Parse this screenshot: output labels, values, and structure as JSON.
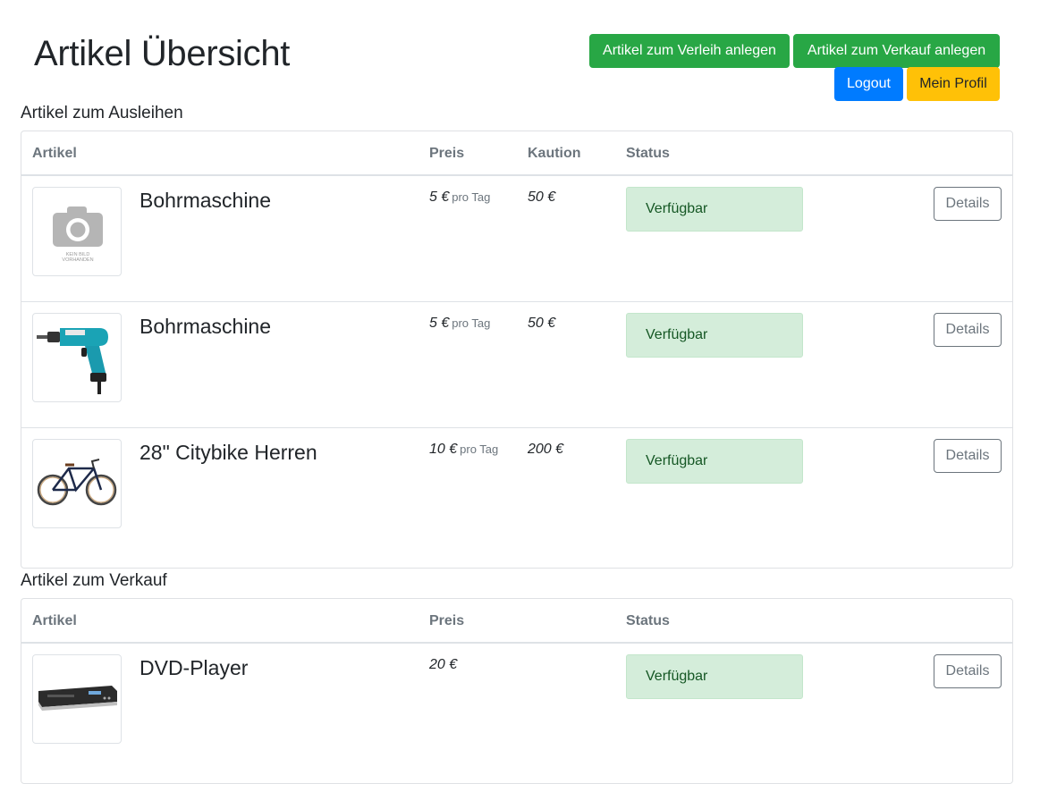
{
  "page": {
    "title": "Artikel Übersicht"
  },
  "header_buttons": {
    "verleih": "Artikel zum Verleih anlegen",
    "verkauf": "Artikel zum Verkauf anlegen",
    "logout": "Logout",
    "profil": "Mein Profil"
  },
  "rental": {
    "title": "Artikel zum Ausleihen",
    "columns": {
      "artikel": "Artikel",
      "preis": "Preis",
      "kaution": "Kaution",
      "status": "Status"
    },
    "items": [
      {
        "name": "Bohrmaschine",
        "price": "5 €",
        "unit": "pro Tag",
        "deposit": "50 €",
        "status": "Verfügbar",
        "details": "Details",
        "image": "kein-bild-icon",
        "image_text": "KEIN BILD VORHANDEN"
      },
      {
        "name": "Bohrmaschine",
        "price": "5 €",
        "unit": "pro Tag",
        "deposit": "50 €",
        "status": "Verfügbar",
        "details": "Details",
        "image": "drill-photo"
      },
      {
        "name": "28\" Citybike Herren",
        "price": "10 €",
        "unit": "pro Tag",
        "deposit": "200 €",
        "status": "Verfügbar",
        "details": "Details",
        "image": "bike-photo"
      }
    ]
  },
  "sale": {
    "title": "Artikel zum Verkauf",
    "columns": {
      "artikel": "Artikel",
      "preis": "Preis",
      "status": "Status"
    },
    "items": [
      {
        "name": "DVD-Player",
        "price": "20 €",
        "status": "Verfügbar",
        "details": "Details",
        "image": "dvd-player-photo"
      }
    ]
  },
  "colors": {
    "success": "#28a745",
    "primary": "#007bff",
    "warning": "#ffc107",
    "status_bg": "#d4edda",
    "status_text": "#155724"
  }
}
